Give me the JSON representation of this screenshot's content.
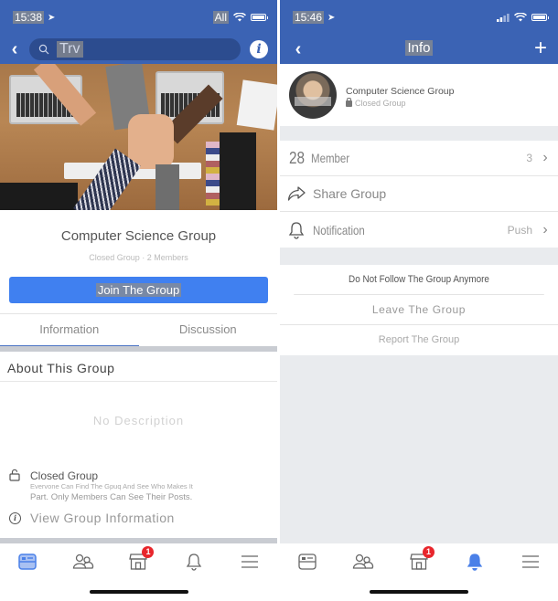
{
  "left": {
    "status": {
      "time": "15:38",
      "carrier": "All"
    },
    "search": {
      "query": "Trv"
    },
    "group": {
      "name": "Computer Science Group",
      "meta": "Closed Group · 2 Members",
      "join_label": "Join The Group"
    },
    "tabs": [
      {
        "label": "Information",
        "active": true
      },
      {
        "label": "Discussion",
        "active": false
      }
    ],
    "about": {
      "title": "About This Group",
      "no_description": "No Description",
      "privacy_title": "Closed Group",
      "privacy_desc_line1": "Evervone Can Find The Gpuq And See Who Makes It",
      "privacy_desc_line2": "Part. Only Members Can See Their Posts.",
      "view_info_label": "View Group Information"
    },
    "tabbar": {
      "active": "news-feed",
      "marketplace_badge": "1"
    }
  },
  "right": {
    "status": {
      "time": "15:46"
    },
    "header": {
      "title": "Info"
    },
    "profile": {
      "name": "Computer Science Group",
      "privacy": "Closed Group"
    },
    "rows": {
      "member_prefix": "28",
      "member_label": "Member",
      "member_count": "3",
      "share_label": "Share Group",
      "notification_label": "Notification",
      "notification_value": "Push"
    },
    "actions": {
      "unfollow": "Do Not Follow The Group Anymore",
      "leave": "Leave The Group",
      "report": "Report The Group"
    },
    "tabbar": {
      "active": "notifications",
      "marketplace_badge": "1"
    }
  },
  "colors": {
    "header_blue": "#3b63b4",
    "button_blue": "#4080f0",
    "badge_red": "#e8262c",
    "active_icon_blue": "#4a80e8"
  }
}
